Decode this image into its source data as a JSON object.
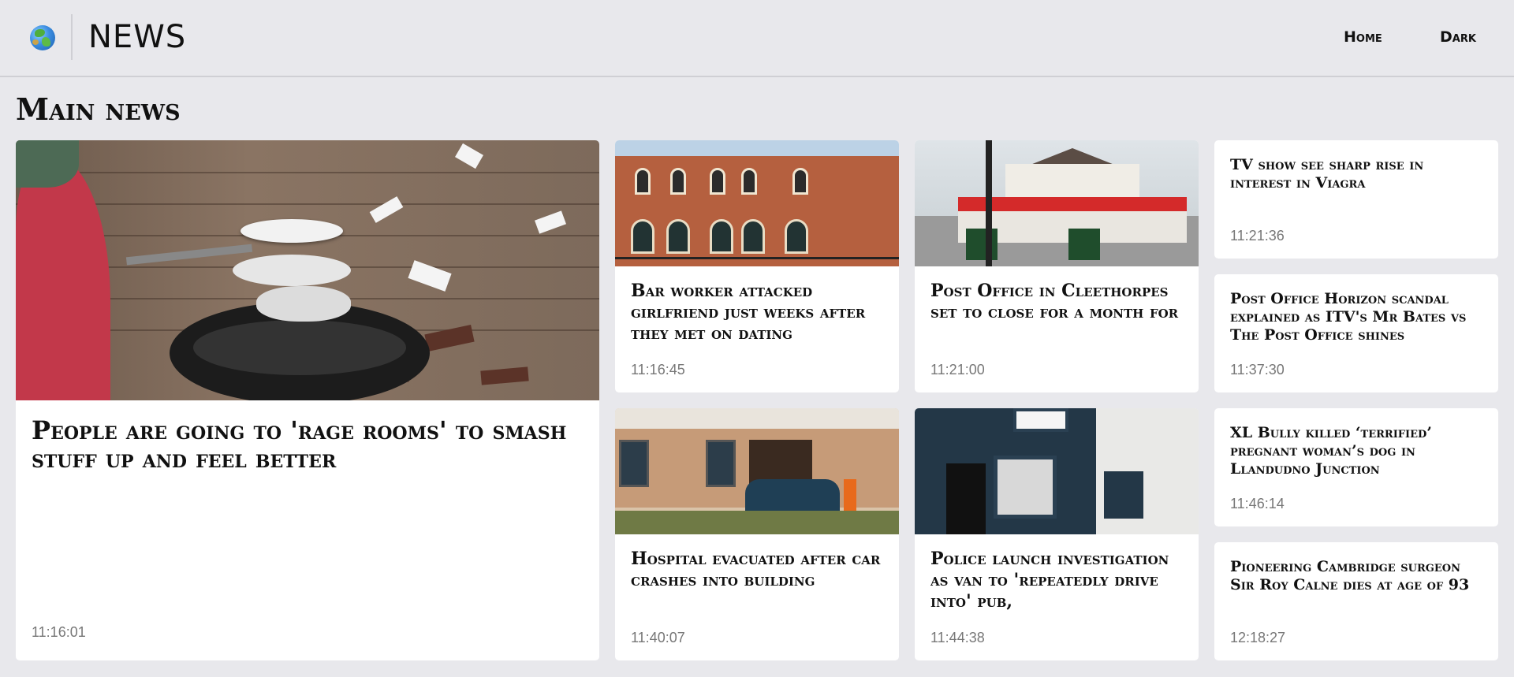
{
  "header": {
    "brand": "NEWS",
    "logo_icon": "globe-icon",
    "nav": {
      "home": "Home",
      "dark": "Dark"
    }
  },
  "section": {
    "title": "Main news"
  },
  "featured": {
    "title": "People are going to 'rage rooms' to smash stuff up and feel better",
    "time": "11:16:01",
    "image": "rage-room-image"
  },
  "image_cards": [
    {
      "title": "Bar worker attacked girlfriend just weeks after they met on dating",
      "time": "11:16:45",
      "image": "court-building-image"
    },
    {
      "title": "Post Office in Cleethorpes set to close for a month for",
      "time": "11:21:00",
      "image": "shop-front-image"
    },
    {
      "title": "Hospital evacuated after car crashes into building",
      "time": "11:40:07",
      "image": "car-crash-image"
    },
    {
      "title": "Police launch investigation as van to 'repeatedly drive into' pub,",
      "time": "11:44:38",
      "image": "pub-front-image"
    }
  ],
  "text_cards": [
    {
      "title": "TV show see sharp rise in interest in Viagra",
      "time": "11:21:36"
    },
    {
      "title": "Post Office Horizon scandal explained as ITV's Mr Bates vs The Post Office shines",
      "time": "11:37:30"
    },
    {
      "title": "XL Bully killed ‘terrified’ pregnant woman’s dog in Llandudno Junction",
      "time": "11:46:14"
    },
    {
      "title": "Pioneering Cambridge surgeon Sir Roy Calne dies at age of 93",
      "time": "12:18:27"
    }
  ]
}
